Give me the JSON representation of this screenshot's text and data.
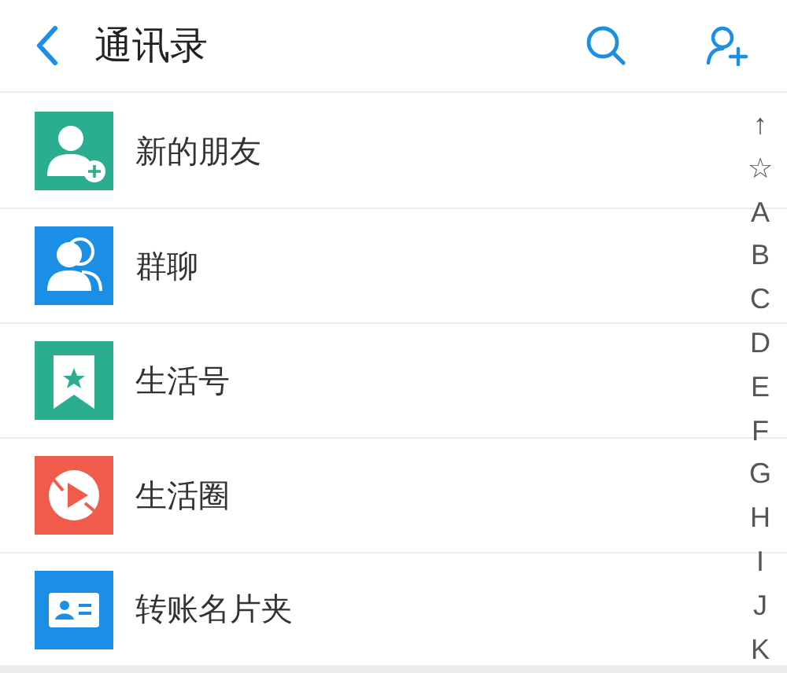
{
  "header": {
    "title": "通讯录"
  },
  "items": [
    {
      "kind": "new-friend",
      "label": "新的朋友"
    },
    {
      "kind": "group",
      "label": "群聊"
    },
    {
      "kind": "bookmark",
      "label": "生活号"
    },
    {
      "kind": "play",
      "label": "生活圈"
    },
    {
      "kind": "card",
      "label": "转账名片夹"
    }
  ],
  "index": [
    "↑",
    "☆",
    "A",
    "B",
    "C",
    "D",
    "E",
    "F",
    "G",
    "H",
    "I",
    "J",
    "K"
  ]
}
